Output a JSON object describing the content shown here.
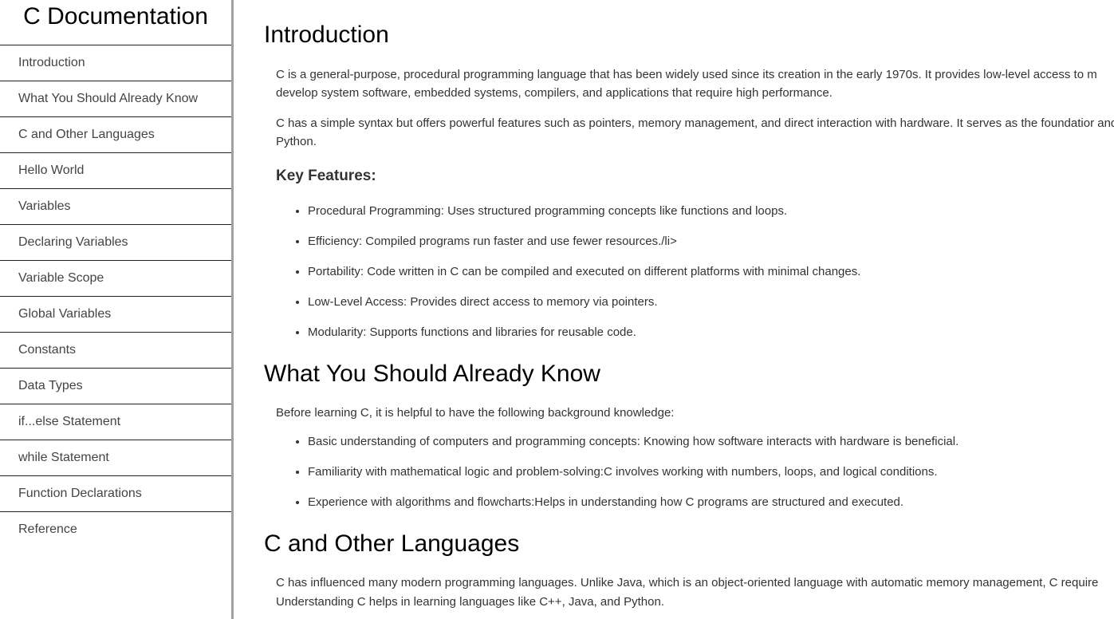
{
  "sidebar": {
    "title": "C Documentation",
    "items": [
      {
        "label": "Introduction"
      },
      {
        "label": "What You Should Already Know"
      },
      {
        "label": "C and Other Languages"
      },
      {
        "label": "Hello World"
      },
      {
        "label": "Variables"
      },
      {
        "label": "Declaring Variables"
      },
      {
        "label": "Variable Scope"
      },
      {
        "label": "Global Variables"
      },
      {
        "label": "Constants"
      },
      {
        "label": "Data Types"
      },
      {
        "label": "if...else Statement"
      },
      {
        "label": "while Statement"
      },
      {
        "label": "Function Declarations"
      },
      {
        "label": "Reference"
      }
    ]
  },
  "main": {
    "introduction": {
      "heading": "Introduction",
      "para1": "C is a general-purpose, procedural programming language that has been widely used since its creation in the early 1970s. It provides low-level access to m develop system software, embedded systems, compilers, and applications that require high performance.",
      "para2": "C has a simple syntax but offers powerful features such as pointers, memory management, and direct interaction with hardware. It serves as the foundatior and Python.",
      "features_heading": "Key Features:",
      "features": [
        "Procedural Programming: Uses structured programming concepts like functions and loops.",
        "Efficiency: Compiled programs run faster and use fewer resources./li>",
        "Portability: Code written in C can be compiled and executed on different platforms with minimal changes.",
        "Low-Level Access: Provides direct access to memory via pointers.",
        "Modularity: Supports functions and libraries for reusable code."
      ]
    },
    "know": {
      "heading": "What You Should Already Know",
      "para1": "Before learning C, it is helpful to have the following background knowledge:",
      "items": [
        "Basic understanding of computers and programming concepts: Knowing how software interacts with hardware is beneficial.",
        "Familiarity with mathematical logic and problem-solving:C involves working with numbers, loops, and logical conditions.",
        "Experience with algorithms and flowcharts:Helps in understanding how C programs are structured and executed."
      ]
    },
    "other": {
      "heading": "C and Other Languages",
      "para1": "C has influenced many modern programming languages. Unlike Java, which is an object-oriented language with automatic memory management, C require Understanding C helps in learning languages like C++, Java, and Python."
    }
  }
}
